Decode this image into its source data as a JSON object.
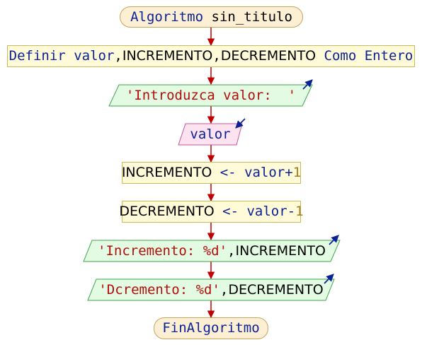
{
  "title": {
    "keyword": "Algoritmo",
    "name": "sin_titulo"
  },
  "definir": {
    "keyword": "Definir",
    "var1": "valor",
    "comma1": ",",
    "var2": "INCREMENTO",
    "comma2": ",",
    "var3": "DECREMENTO",
    "type_phrase": "Como Entero"
  },
  "escribir1": {
    "text": "'Introduzca valor:  '"
  },
  "leer": {
    "var": "valor"
  },
  "asignar1": {
    "target": "INCREMENTO",
    "arrow": "<-",
    "source": "valor",
    "operator": "+",
    "number": "1"
  },
  "asignar2": {
    "target": "DECREMENTO",
    "arrow": "<-",
    "source": "valor",
    "operator": "-",
    "number": "1"
  },
  "escribir2": {
    "string": "'Incremento: %d'",
    "comma": ",",
    "var": "INCREMENTO"
  },
  "escribir3": {
    "string": "'Dcremento: %d'",
    "comma": ",",
    "var": "DECREMENTO"
  },
  "fin": {
    "keyword": "FinAlgoritmo"
  },
  "colors": {
    "connector": "#c00000",
    "keyword": "#0b2296",
    "string": "#b40d0d",
    "number": "#a37d19",
    "terminal_fill": "#fdefd4",
    "process_fill": "#fffbd9",
    "output_fill": "#e2fbe2",
    "input_fill": "#fde3f0"
  },
  "icons": {
    "output": "arrow-up-right-icon",
    "input": "arrow-down-left-icon"
  }
}
